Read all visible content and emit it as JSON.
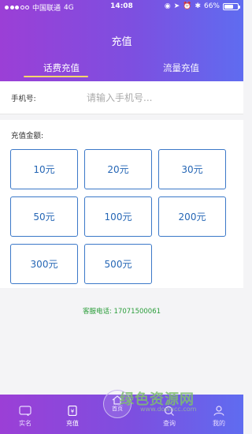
{
  "status_bar": {
    "carrier": "中国联通",
    "network": "4G",
    "time": "14:08",
    "battery": "66%",
    "battery_level": 0.66
  },
  "header": {
    "title": "充值"
  },
  "tabs": [
    {
      "label": "话费充值",
      "active": true
    },
    {
      "label": "流量充值",
      "active": false
    }
  ],
  "phone": {
    "label": "手机号:",
    "placeholder": "请输入手机号..."
  },
  "amount": {
    "label": "充值金额:",
    "options": [
      "10元",
      "20元",
      "30元",
      "50元",
      "100元",
      "200元",
      "300元",
      "500元"
    ]
  },
  "service": {
    "text": "客服电话: 17071500061"
  },
  "watermark": {
    "text": "绿色资源网",
    "sub": "www.downcc.com"
  },
  "tabbar": {
    "items": [
      {
        "label": "实名",
        "icon": "id-card-icon"
      },
      {
        "label": "充值",
        "icon": "recharge-icon"
      },
      {
        "label": "首页",
        "icon": "home-icon"
      },
      {
        "label": "查询",
        "icon": "search-icon"
      },
      {
        "label": "我的",
        "icon": "user-icon"
      }
    ]
  },
  "colors": {
    "accent_left": "#9b3fd6",
    "accent_right": "#5f6cf0",
    "button_border": "#3b78c8",
    "service_text": "#2a9d3a",
    "tab_underline": "#f6d66c"
  }
}
